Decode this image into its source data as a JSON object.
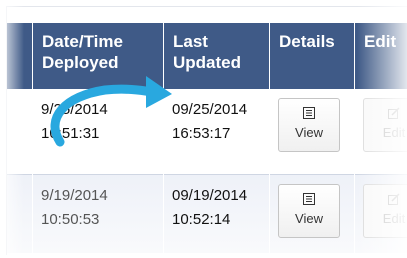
{
  "table": {
    "headers": {
      "date_deployed": "Date/Time Deployed",
      "last_updated": "Last Updated",
      "details": "Details",
      "edit": "Edit"
    },
    "rows": [
      {
        "deployed_date": "9/25/2014",
        "deployed_time": "10:51:31",
        "updated_date": "09/25/2014",
        "updated_time": "16:53:17",
        "details_button": "View",
        "edit_button": "Edit"
      },
      {
        "deployed_date": "9/19/2014",
        "deployed_time": "10:50:53",
        "updated_date": "09/19/2014",
        "updated_time": "10:52:14",
        "details_button": "View",
        "edit_button": "Edit"
      }
    ]
  },
  "colors": {
    "header_bg": "#3f5a87",
    "arrow": "#29a8df"
  },
  "icons": [
    "list-icon",
    "edit-pencil-icon",
    "curved-arrow-icon"
  ]
}
